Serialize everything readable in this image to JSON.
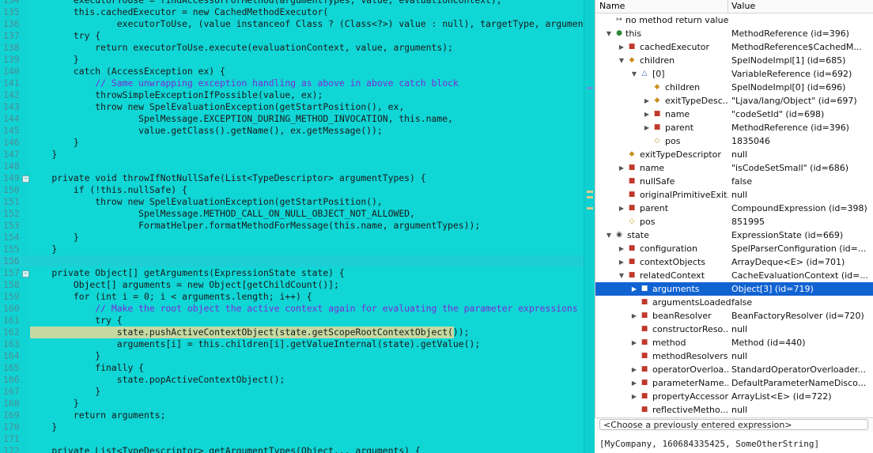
{
  "colors": {
    "editor_bg": "#10d6d6",
    "selection": "#1263d2",
    "comment": "#7c2ad6",
    "keyword": "#6b0f6b"
  },
  "editor": {
    "lines": [
      {
        "n": "134",
        "text": "        executorToUse = findAccessorForMethod(argumentTypes, value, evaluationContext);"
      },
      {
        "n": "135",
        "text": "        this.cachedExecutor = new CachedMethodExecutor("
      },
      {
        "n": "136",
        "text": "                executorToUse, (value instanceof Class ? (Class<?>) value : null), targetType, argumentTypes.size());"
      },
      {
        "n": "137",
        "text": "        try {"
      },
      {
        "n": "138",
        "text": "            return executorToUse.execute(evaluationContext, value, arguments);"
      },
      {
        "n": "139",
        "text": "        }"
      },
      {
        "n": "140",
        "text": "        catch (AccessException ex) {"
      },
      {
        "n": "141",
        "text": "            // Same unwrapping exception handling as above in above catch block"
      },
      {
        "n": "142",
        "text": "            throwSimpleExceptionIfPossible(value, ex);"
      },
      {
        "n": "143",
        "text": "            throw new SpelEvaluationException(getStartPosition(), ex,"
      },
      {
        "n": "144",
        "text": "                    SpelMessage.EXCEPTION_DURING_METHOD_INVOCATION, this.name,"
      },
      {
        "n": "145",
        "text": "                    value.getClass().getName(), ex.getMessage());"
      },
      {
        "n": "146",
        "text": "        }"
      },
      {
        "n": "147",
        "text": "    }"
      },
      {
        "n": "148",
        "text": ""
      },
      {
        "n": "149",
        "text": "    private void throwIfNotNullSafe(List<TypeDescriptor> argumentTypes) {"
      },
      {
        "n": "150",
        "text": "        if (!this.nullSafe) {"
      },
      {
        "n": "151",
        "text": "            throw new SpelEvaluationException(getStartPosition(),"
      },
      {
        "n": "152",
        "text": "                    SpelMessage.METHOD_CALL_ON_NULL_OBJECT_NOT_ALLOWED,"
      },
      {
        "n": "153",
        "text": "                    FormatHelper.formatMethodForMessage(this.name, argumentTypes));"
      },
      {
        "n": "154",
        "text": "        }"
      },
      {
        "n": "155",
        "text": "    }"
      },
      {
        "n": "156",
        "text": ""
      },
      {
        "n": "157",
        "text": "    private Object[] getArguments(ExpressionState state) {"
      },
      {
        "n": "158",
        "text": "        Object[] arguments = new Object[getChildCount()];"
      },
      {
        "n": "159",
        "text": "        for (int i = 0; i < arguments.length; i++) {"
      },
      {
        "n": "160",
        "text": "            // Make the root object the active context again for evaluating the parameter expressions"
      },
      {
        "n": "161",
        "text": "            try {"
      },
      {
        "n": "162",
        "text": "                state.pushActiveContextObject(state.getScopeRootContextObject());"
      },
      {
        "n": "163",
        "text": "                arguments[i] = this.children[i].getValueInternal(state).getValue();"
      },
      {
        "n": "164",
        "text": "            }"
      },
      {
        "n": "165",
        "text": "            finally {"
      },
      {
        "n": "166",
        "text": "                state.popActiveContextObject();"
      },
      {
        "n": "167",
        "text": "            }"
      },
      {
        "n": "168",
        "text": "        }"
      },
      {
        "n": "169",
        "text": "        return arguments;"
      },
      {
        "n": "170",
        "text": "    }"
      },
      {
        "n": "171",
        "text": ""
      },
      {
        "n": "172",
        "text": "    private List<TypeDescriptor> getArgumentTypes(Object... arguments) {"
      }
    ]
  },
  "variables": {
    "header": {
      "name": "Name",
      "value": "Value"
    },
    "rows": [
      {
        "name": "no method return value",
        "value": "",
        "icon": "return-arrow-icon"
      },
      {
        "name": "this",
        "value": "MethodReference  (id=396)",
        "icon": "local-variable-icon"
      },
      {
        "name": "cachedExecutor",
        "value": "MethodReference$CachedM...",
        "icon": "private-field-icon"
      },
      {
        "name": "children",
        "value": "SpelNodeImpl[1]  (id=685)",
        "icon": "protected-field-icon"
      },
      {
        "name": "[0]",
        "value": "VariableReference  (id=692)",
        "icon": "array-element-icon"
      },
      {
        "name": "children",
        "value": "SpelNodeImpl[0]  (id=696)",
        "icon": "protected-field-icon"
      },
      {
        "name": "exitTypeDesc...",
        "value": "\"Ljava/lang/Object\" (id=697)",
        "icon": "protected-field-icon"
      },
      {
        "name": "name",
        "value": "\"codeSetId\" (id=698)",
        "icon": "private-final-field-icon"
      },
      {
        "name": "parent",
        "value": "MethodReference  (id=396)",
        "icon": "private-field-icon"
      },
      {
        "name": "pos",
        "value": "1835046",
        "icon": "protected-final-field-icon"
      },
      {
        "name": "exitTypeDescriptor",
        "value": "null",
        "icon": "protected-field-icon"
      },
      {
        "name": "name",
        "value": "\"isCodeSetSmall\" (id=686)",
        "icon": "private-final-field-icon"
      },
      {
        "name": "nullSafe",
        "value": "false",
        "icon": "private-final-field-icon"
      },
      {
        "name": "originalPrimitiveExit...",
        "value": "null",
        "icon": "private-field-icon"
      },
      {
        "name": "parent",
        "value": "CompoundExpression  (id=398)",
        "icon": "private-field-icon"
      },
      {
        "name": "pos",
        "value": "851995",
        "icon": "protected-final-field-icon"
      },
      {
        "name": "state",
        "value": "ExpressionState  (id=669)",
        "icon": "parameter-icon"
      },
      {
        "name": "configuration",
        "value": "SpelParserConfiguration  (id=...",
        "icon": "private-final-field-icon"
      },
      {
        "name": "contextObjects",
        "value": "ArrayDeque<E>  (id=701)",
        "icon": "private-field-icon"
      },
      {
        "name": "relatedContext",
        "value": "CacheEvaluationContext  (id=...",
        "icon": "private-final-field-icon"
      },
      {
        "name": "arguments",
        "value": "Object[3]  (id=719)",
        "icon": "private-final-field-icon"
      },
      {
        "name": "argumentsLoaded",
        "value": "false",
        "icon": "private-field-icon"
      },
      {
        "name": "beanResolver",
        "value": "BeanFactoryResolver  (id=720)",
        "icon": "private-field-icon"
      },
      {
        "name": "constructorReso...",
        "value": "null",
        "icon": "private-field-icon"
      },
      {
        "name": "method",
        "value": "Method  (id=440)",
        "icon": "private-final-field-icon"
      },
      {
        "name": "methodResolvers",
        "value": "null",
        "icon": "private-field-icon"
      },
      {
        "name": "operatorOverloa...",
        "value": "StandardOperatorOverloader...",
        "icon": "private-field-icon"
      },
      {
        "name": "parameterName...",
        "value": "DefaultParameterNameDisco...",
        "icon": "private-final-field-icon"
      },
      {
        "name": "propertyAccessors",
        "value": "ArrayList<E>  (id=722)",
        "icon": "private-field-icon"
      },
      {
        "name": "reflectiveMetho...",
        "value": "null",
        "icon": "private-field-icon"
      }
    ]
  },
  "expression": {
    "placeholder": "<Choose a previously entered expression>"
  },
  "detail": {
    "text": "[MyCompany, 160684335425, SomeOtherString]"
  }
}
